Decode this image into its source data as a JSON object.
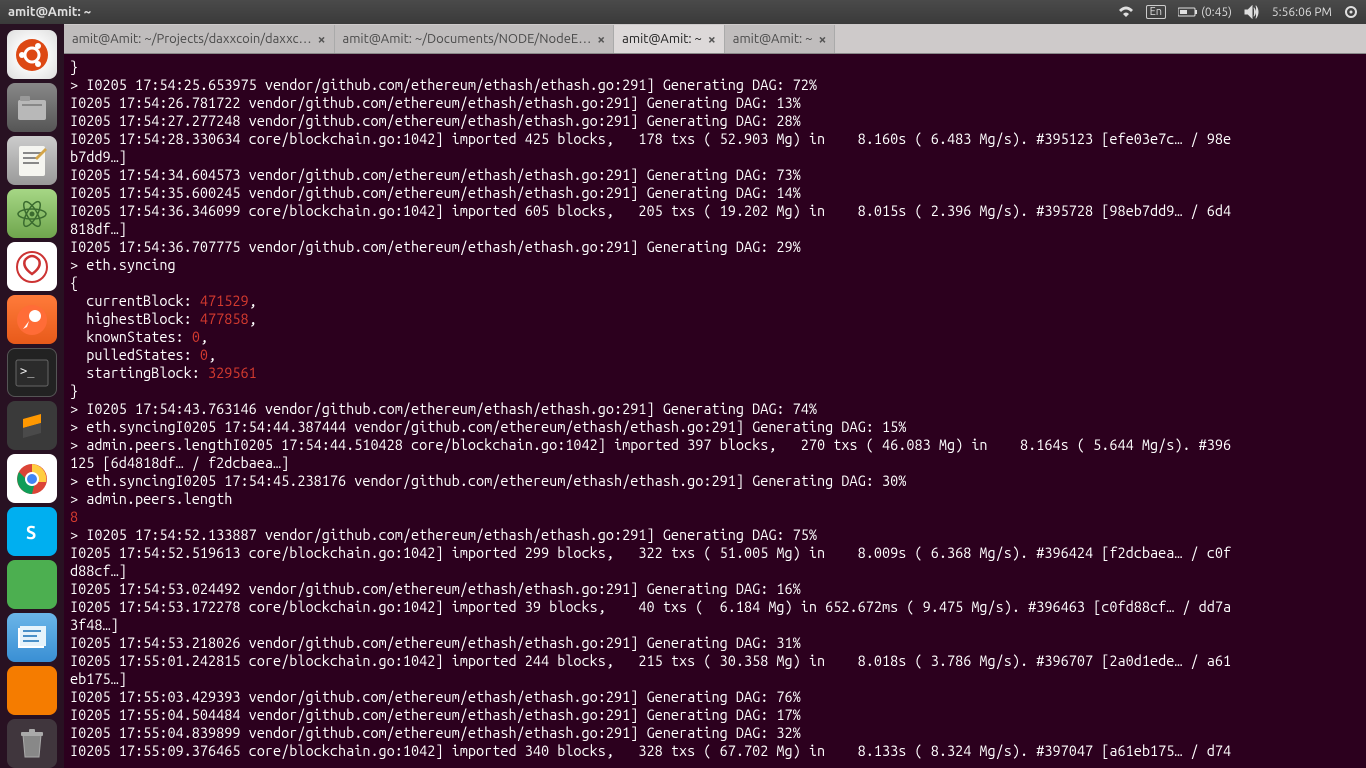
{
  "topbar": {
    "title": "amit@Amit: ~",
    "lang": "En",
    "battery": "(0:45)",
    "time": "5:56:06 PM"
  },
  "tabs": [
    {
      "label": "amit@Amit: ~/Projects/daxxcoin/daxxc…",
      "active": false
    },
    {
      "label": "amit@Amit: ~/Documents/NODE/NodeE…",
      "active": false
    },
    {
      "label": "amit@Amit: ~",
      "active": true
    },
    {
      "label": "amit@Amit: ~",
      "active": false
    }
  ],
  "term": {
    "l01": "}",
    "l02": "> I0205 17:54:25.653975 vendor/github.com/ethereum/ethash/ethash.go:291] Generating DAG: 72%",
    "l03": "I0205 17:54:26.781722 vendor/github.com/ethereum/ethash/ethash.go:291] Generating DAG: 13%",
    "l04": "I0205 17:54:27.277248 vendor/github.com/ethereum/ethash/ethash.go:291] Generating DAG: 28%",
    "l05": "I0205 17:54:28.330634 core/blockchain.go:1042] imported 425 blocks,   178 txs ( 52.903 Mg) in    8.160s ( 6.483 Mg/s). #395123 [efe03e7c… / 98e",
    "l06": "b7dd9…]",
    "l07": "I0205 17:54:34.604573 vendor/github.com/ethereum/ethash/ethash.go:291] Generating DAG: 73%",
    "l08": "I0205 17:54:35.600245 vendor/github.com/ethereum/ethash/ethash.go:291] Generating DAG: 14%",
    "l09": "I0205 17:54:36.346099 core/blockchain.go:1042] imported 605 blocks,   205 txs ( 19.202 Mg) in    8.015s ( 2.396 Mg/s). #395728 [98eb7dd9… / 6d4",
    "l10": "818df…]",
    "l11": "I0205 17:54:36.707775 vendor/github.com/ethereum/ethash/ethash.go:291] Generating DAG: 29%",
    "l12": "> eth.syncing",
    "l13": "{",
    "l14a": "  currentBlock: ",
    "l14b": "471529",
    "l14c": ",",
    "l15a": "  highestBlock: ",
    "l15b": "477858",
    "l15c": ",",
    "l16a": "  knownStates: ",
    "l16b": "0",
    "l16c": ",",
    "l17a": "  pulledStates: ",
    "l17b": "0",
    "l17c": ",",
    "l18a": "  startingBlock: ",
    "l18b": "329561",
    "l19": "}",
    "l20": "> I0205 17:54:43.763146 vendor/github.com/ethereum/ethash/ethash.go:291] Generating DAG: 74%",
    "l21": "> eth.syncingI0205 17:54:44.387444 vendor/github.com/ethereum/ethash/ethash.go:291] Generating DAG: 15%",
    "l22": "> admin.peers.lengthI0205 17:54:44.510428 core/blockchain.go:1042] imported 397 blocks,   270 txs ( 46.083 Mg) in    8.164s ( 5.644 Mg/s). #396",
    "l23": "125 [6d4818df… / f2dcbaea…]",
    "l24": "> eth.syncingI0205 17:54:45.238176 vendor/github.com/ethereum/ethash/ethash.go:291] Generating DAG: 30%",
    "l25": "> admin.peers.length",
    "l26": "8",
    "l27": "> I0205 17:54:52.133887 vendor/github.com/ethereum/ethash/ethash.go:291] Generating DAG: 75%",
    "l28": "I0205 17:54:52.519613 core/blockchain.go:1042] imported 299 blocks,   322 txs ( 51.005 Mg) in    8.009s ( 6.368 Mg/s). #396424 [f2dcbaea… / c0f",
    "l29": "d88cf…]",
    "l30": "I0205 17:54:53.024492 vendor/github.com/ethereum/ethash/ethash.go:291] Generating DAG: 16%",
    "l31": "I0205 17:54:53.172278 core/blockchain.go:1042] imported 39 blocks,    40 txs (  6.184 Mg) in 652.672ms ( 9.475 Mg/s). #396463 [c0fd88cf… / dd7a",
    "l32": "3f48…]",
    "l33": "I0205 17:54:53.218026 vendor/github.com/ethereum/ethash/ethash.go:291] Generating DAG: 31%",
    "l34": "I0205 17:55:01.242815 core/blockchain.go:1042] imported 244 blocks,   215 txs ( 30.358 Mg) in    8.018s ( 3.786 Mg/s). #396707 [2a0d1ede… / a61",
    "l35": "eb175…]",
    "l36": "I0205 17:55:03.429393 vendor/github.com/ethereum/ethash/ethash.go:291] Generating DAG: 76%",
    "l37": "I0205 17:55:04.504484 vendor/github.com/ethereum/ethash/ethash.go:291] Generating DAG: 17%",
    "l38": "I0205 17:55:04.839899 vendor/github.com/ethereum/ethash/ethash.go:291] Generating DAG: 32%",
    "l39": "I0205 17:55:09.376465 core/blockchain.go:1042] imported 340 blocks,   328 txs ( 67.702 Mg) in    8.133s ( 8.324 Mg/s). #397047 [a61eb175… / d74"
  }
}
